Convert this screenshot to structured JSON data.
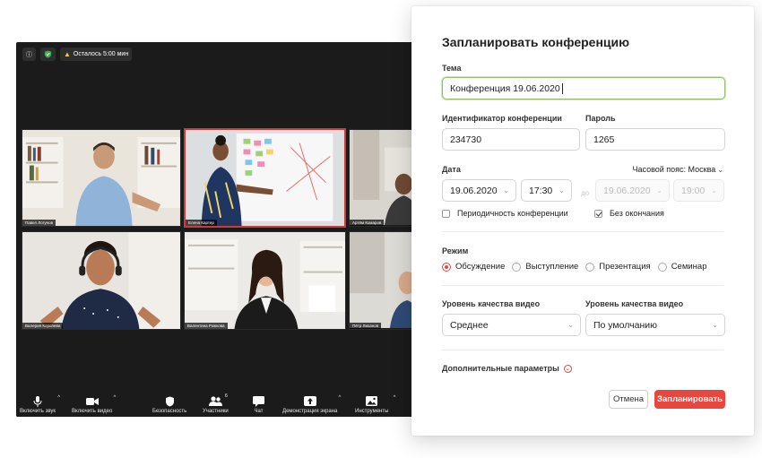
{
  "video": {
    "timer_text": "Осталось 5:00 мин",
    "participants": [
      {
        "name": "Павел Логунов"
      },
      {
        "name": "Елена Картер"
      },
      {
        "name": "Артём Комаров"
      },
      {
        "name": "Валерия Королева"
      },
      {
        "name": "Валентина Рожкова"
      },
      {
        "name": "Пётр Лиханов"
      }
    ],
    "toolbar": {
      "mic_label": "Включить звук",
      "video_label": "Включить видео",
      "security_label": "Безопасность",
      "participants_label": "Участники",
      "participants_count": "6",
      "chat_label": "Чат",
      "share_label": "Демонстрация экрана",
      "tools_label": "Инструменты"
    }
  },
  "dialog": {
    "title": "Запланировать конференцию",
    "topic_label": "Тема",
    "topic_value": "Конференция 19.06.2020",
    "meeting_id_label": "Идентификатор конференции",
    "meeting_id_value": "234730",
    "password_label": "Пароль",
    "password_value": "1265",
    "date_label": "Дата",
    "timezone": "Часовой пояс: Москва",
    "start_date": "19.06.2020",
    "start_time": "17:30",
    "to_label": "до",
    "end_date": "19.06.2020",
    "end_time": "19:00",
    "recurring_label": "Периодичность конференции",
    "recurring_checked": false,
    "no_end_label": "Без окончания",
    "no_end_checked": true,
    "mode_label": "Режим",
    "modes": [
      "Обсуждение",
      "Выступление",
      "Презентация",
      "Семинар"
    ],
    "selected_mode": "Обсуждение",
    "quality_label_1": "Уровень качества видео",
    "quality_value_1": "Среднее",
    "quality_label_2": "Уровень качества видео",
    "quality_value_2": "По умолчанию",
    "advanced_label": "Дополнительные параметры",
    "cancel_label": "Отмена",
    "submit_label": "Запланировать"
  },
  "colors": {
    "accent": "#e8473f",
    "focus": "#8fbf68",
    "video_bg": "#1b1b1b"
  }
}
